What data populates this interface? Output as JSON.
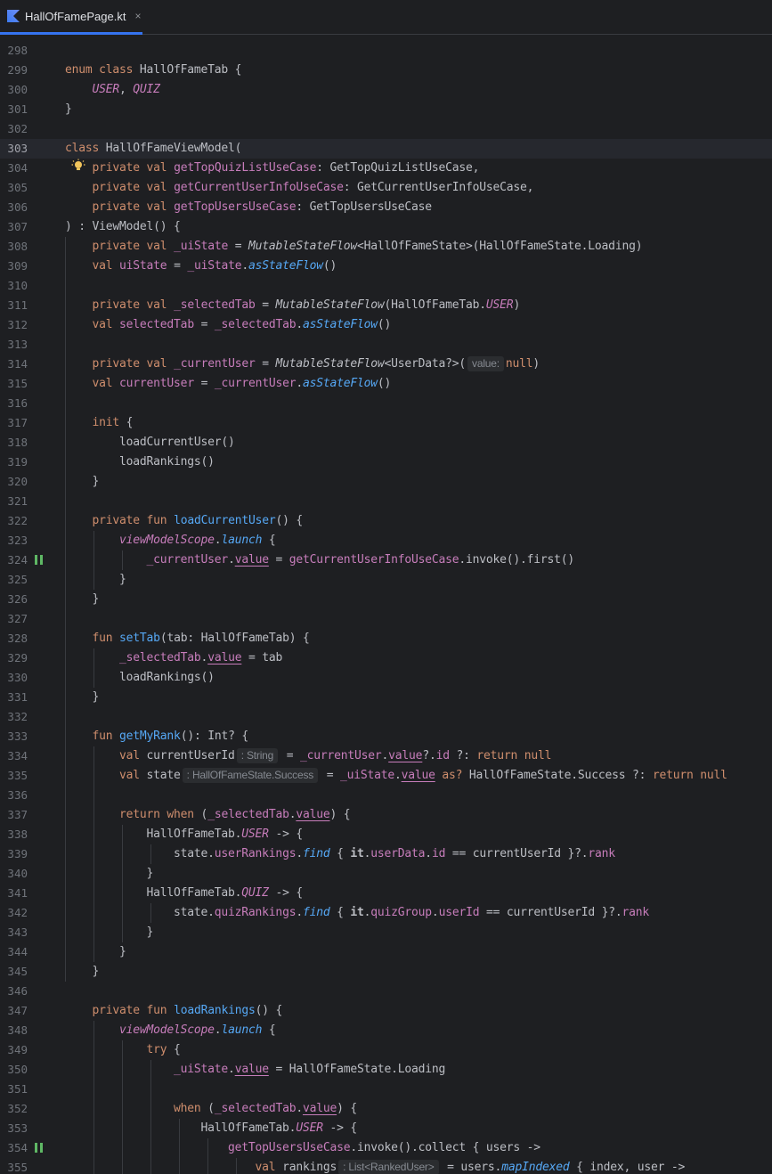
{
  "tab": {
    "file_name": "HallOfFamePage.kt",
    "close_glyph": "×",
    "icon": "kotlin-file-icon"
  },
  "editor": {
    "current_line": 303,
    "lines": [
      {
        "n": "298",
        "html": ""
      },
      {
        "n": "299",
        "html": "<span class=\"kw\">enum class</span> HallOfFameTab {"
      },
      {
        "n": "300",
        "html": "    <span class=\"enumv\">USER</span>, <span class=\"enumv\">QUIZ</span>"
      },
      {
        "n": "301",
        "html": "}"
      },
      {
        "n": "302",
        "html": ""
      },
      {
        "n": "303",
        "html": "<span class=\"kw\">class</span> HallOfFameViewModel("
      },
      {
        "n": "304",
        "html": "    <span class=\"kw\">private val</span> <span class=\"prop\">getTopQuizListUseCase</span>: GetTopQuizListUseCase,"
      },
      {
        "n": "305",
        "html": "    <span class=\"kw\">private val</span> <span class=\"prop\">getCurrentUserInfoUseCase</span>: GetCurrentUserInfoUseCase,"
      },
      {
        "n": "306",
        "html": "    <span class=\"kw\">private val</span> <span class=\"prop\">getTopUsersUseCase</span>: GetTopUsersUseCase"
      },
      {
        "n": "307",
        "html": ") : ViewModel() {"
      },
      {
        "n": "308",
        "html": "    <span class=\"kw\">private val</span> <span class=\"prop\">_uiState</span> = <span class=\"ext\">MutableStateFlow</span>&lt;HallOfFameState&gt;(HallOfFameState.Loading)"
      },
      {
        "n": "309",
        "html": "    <span class=\"kw\">val</span> <span class=\"prop\">uiState</span> = <span class=\"prop\">_uiState</span>.<span class=\"italic-fn\">asStateFlow</span>()"
      },
      {
        "n": "310",
        "html": ""
      },
      {
        "n": "311",
        "html": "    <span class=\"kw\">private val</span> <span class=\"prop\">_selectedTab</span> = <span class=\"ext\">MutableStateFlow</span>(HallOfFameTab.<span class=\"enumv\">USER</span>)"
      },
      {
        "n": "312",
        "html": "    <span class=\"kw\">val</span> <span class=\"prop\">selectedTab</span> = <span class=\"prop\">_selectedTab</span>.<span class=\"italic-fn\">asStateFlow</span>()"
      },
      {
        "n": "313",
        "html": ""
      },
      {
        "n": "314",
        "html": "    <span class=\"kw\">private val</span> <span class=\"prop\">_currentUser</span> = <span class=\"ext\">MutableStateFlow</span>&lt;UserData?&gt;(<span class=\"hint\">value:</span><span class=\"kw\">null</span>)"
      },
      {
        "n": "315",
        "html": "    <span class=\"kw\">val</span> <span class=\"prop\">currentUser</span> = <span class=\"prop\">_currentUser</span>.<span class=\"italic-fn\">asStateFlow</span>()"
      },
      {
        "n": "316",
        "html": ""
      },
      {
        "n": "317",
        "html": "    <span class=\"kw\">init</span> {"
      },
      {
        "n": "318",
        "html": "        loadCurrentUser()"
      },
      {
        "n": "319",
        "html": "        loadRankings()"
      },
      {
        "n": "320",
        "html": "    }"
      },
      {
        "n": "321",
        "html": ""
      },
      {
        "n": "322",
        "html": "    <span class=\"kw\">private fun</span> <span class=\"fn\">loadCurrentUser</span>() {"
      },
      {
        "n": "323",
        "html": "        <span class=\"ext-purple\">viewModelScope</span>.<span class=\"italic-fn\">launch</span> {"
      },
      {
        "n": "324",
        "html": "            <span class=\"prop\">_currentUser</span>.<span class=\"prop under\">value</span> = <span class=\"prop\">getCurrentUserInfoUseCase</span>.invoke().first()"
      },
      {
        "n": "325",
        "html": "        }"
      },
      {
        "n": "326",
        "html": "    }"
      },
      {
        "n": "327",
        "html": ""
      },
      {
        "n": "328",
        "html": "    <span class=\"kw\">fun</span> <span class=\"fn\">setTab</span>(tab: HallOfFameTab) {"
      },
      {
        "n": "329",
        "html": "        <span class=\"prop\">_selectedTab</span>.<span class=\"prop under\">value</span> = tab"
      },
      {
        "n": "330",
        "html": "        loadRankings()"
      },
      {
        "n": "331",
        "html": "    }"
      },
      {
        "n": "332",
        "html": ""
      },
      {
        "n": "333",
        "html": "    <span class=\"kw\">fun</span> <span class=\"fn\">getMyRank</span>(): Int? {"
      },
      {
        "n": "334",
        "html": "        <span class=\"kw\">val</span> currentUserId<span class=\"hint\">: String</span> = <span class=\"prop\">_currentUser</span>.<span class=\"prop under\">value</span>?.<span class=\"prop\">id</span> ?: <span class=\"kw\">return null</span>"
      },
      {
        "n": "335",
        "html": "        <span class=\"kw\">val</span> state<span class=\"hint\">: HallOfFameState.Success</span> = <span class=\"prop\">_uiState</span>.<span class=\"prop under\">value</span> <span class=\"kw\">as?</span> HallOfFameState.Success ?: <span class=\"kw\">return null</span>"
      },
      {
        "n": "336",
        "html": ""
      },
      {
        "n": "337",
        "html": "        <span class=\"kw\">return when</span> (<span class=\"prop\">_selectedTab</span>.<span class=\"prop under\">value</span>) {"
      },
      {
        "n": "338",
        "html": "            HallOfFameTab.<span class=\"enumv\">USER</span> -&gt; {"
      },
      {
        "n": "339",
        "html": "                state.<span class=\"prop\">userRankings</span>.<span class=\"italic-fn\">find</span> { <b>it</b>.<span class=\"prop\">userData</span>.<span class=\"prop\">id</span> == currentUserId }?.<span class=\"prop\">rank</span>"
      },
      {
        "n": "340",
        "html": "            }"
      },
      {
        "n": "341",
        "html": "            HallOfFameTab.<span class=\"enumv\">QUIZ</span> -&gt; {"
      },
      {
        "n": "342",
        "html": "                state.<span class=\"prop\">quizRankings</span>.<span class=\"italic-fn\">find</span> { <b>it</b>.<span class=\"prop\">quizGroup</span>.<span class=\"prop\">userId</span> == currentUserId }?.<span class=\"prop\">rank</span>"
      },
      {
        "n": "343",
        "html": "            }"
      },
      {
        "n": "344",
        "html": "        }"
      },
      {
        "n": "345",
        "html": "    }"
      },
      {
        "n": "346",
        "html": ""
      },
      {
        "n": "347",
        "html": "    <span class=\"kw\">private fun</span> <span class=\"fn\">loadRankings</span>() {"
      },
      {
        "n": "348",
        "html": "        <span class=\"ext-purple\">viewModelScope</span>.<span class=\"italic-fn\">launch</span> {"
      },
      {
        "n": "349",
        "html": "            <span class=\"kw\">try</span> {"
      },
      {
        "n": "350",
        "html": "                <span class=\"prop\">_uiState</span>.<span class=\"prop under\">value</span> = HallOfFameState.Loading"
      },
      {
        "n": "351",
        "html": ""
      },
      {
        "n": "352",
        "html": "                <span class=\"kw\">when</span> (<span class=\"prop\">_selectedTab</span>.<span class=\"prop under\">value</span>) {"
      },
      {
        "n": "353",
        "html": "                    HallOfFameTab.<span class=\"enumv\">USER</span> -&gt; {"
      },
      {
        "n": "354",
        "html": "                        <span class=\"prop\">getTopUsersUseCase</span>.invoke().collect { users -&gt;"
      },
      {
        "n": "355",
        "html": "                            <span class=\"kw\">val</span> rankings<span class=\"hint\">: List&lt;RankedUser&gt;</span> = users.<span class=\"italic-fn\">mapIndexed</span> { index, user -&gt;"
      }
    ]
  },
  "gutter": {
    "breakpoint_lines": [
      324,
      354
    ],
    "intention_icon": "lightbulb-icon"
  }
}
